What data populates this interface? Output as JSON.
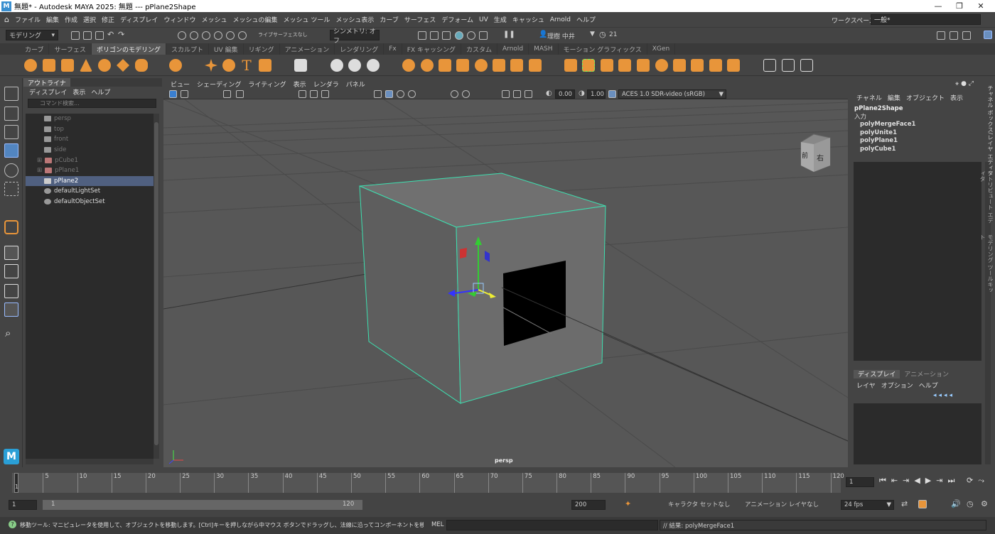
{
  "app": {
    "title": "無題* - Autodesk MAYA 2025: 無題   ---   pPlane2Shape",
    "logo": "M"
  },
  "window_controls": {
    "minimize": "—",
    "maximize": "❐",
    "close": "✕"
  },
  "menubar": {
    "items": [
      "ファイル",
      "編集",
      "作成",
      "選択",
      "修正",
      "ディスプレイ",
      "ウィンドウ",
      "メッシュ",
      "メッシュの編集",
      "メッシュ ツール",
      "メッシュ表示",
      "カーブ",
      "サーフェス",
      "デフォーム",
      "UV",
      "生成",
      "キャッシュ",
      "Arnold",
      "ヘルプ"
    ],
    "workspace_label": "ワークスペース :",
    "workspace_value": "一般*"
  },
  "statusline": {
    "mode": "モデリング",
    "live": "ライブ",
    "surface": "サーフェスなし",
    "symmetry": "シンメトリ: オフ",
    "user": "理樹 中井",
    "notifications": "21"
  },
  "shelf": {
    "tabs": [
      "カーブ",
      "サーフェス",
      "ポリゴンのモデリング",
      "スカルプト",
      "UV 編集",
      "リギング",
      "アニメーション",
      "レンダリング",
      "Fx",
      "FX キャッシング",
      "カスタム",
      "Arnold",
      "MASH",
      "モーション グラフィックス",
      "XGen"
    ],
    "active_tab": 2
  },
  "outliner": {
    "tab": "アウトライナ",
    "menu": [
      "ディスプレイ",
      "表示",
      "ヘルプ"
    ],
    "search_placeholder": "コマンド検索...",
    "items": [
      {
        "label": "persp",
        "dim": true
      },
      {
        "label": "top",
        "dim": true
      },
      {
        "label": "front",
        "dim": true
      },
      {
        "label": "side",
        "dim": true
      },
      {
        "label": "pCube1",
        "dim": true
      },
      {
        "label": "pPlane1",
        "dim": true
      },
      {
        "label": "pPlane2",
        "selected": true
      },
      {
        "label": "defaultLightSet"
      },
      {
        "label": "defaultObjectSet"
      }
    ]
  },
  "viewport": {
    "menu": [
      "ビュー",
      "シェーディング",
      "ライティング",
      "表示",
      "レンダラ",
      "パネル"
    ],
    "exposure": "0.00",
    "gamma": "1.00",
    "colorspace": "ACES 1.0 SDR-video (sRGB)",
    "camera_label": "persp",
    "viewcube": {
      "front": "前",
      "right": "右"
    }
  },
  "channelbox": {
    "menu": [
      "チャネル",
      "編集",
      "オブジェクト",
      "表示"
    ],
    "shape": "pPlane2Shape",
    "input_label": "入力",
    "inputs": [
      "polyMergeFace1",
      "polyUnite1",
      "polyPlane1",
      "polyCube1"
    ],
    "side_tabs": [
      "チャネル ボックス/レイヤ エディタ",
      "アトリビュート エディタ",
      "モデリング ツールキット"
    ],
    "layer_tabs": [
      "ディスプレイ",
      "アニメーション"
    ],
    "layer_menu": [
      "レイヤ",
      "オプション",
      "ヘルプ"
    ]
  },
  "timeline": {
    "ticks": [
      "5",
      "10",
      "15",
      "20",
      "25",
      "30",
      "35",
      "40",
      "45",
      "50",
      "55",
      "60",
      "65",
      "70",
      "75",
      "80",
      "85",
      "90",
      "95",
      "100",
      "105",
      "110",
      "115",
      "120"
    ],
    "start_marker": "1",
    "current_frame": "1"
  },
  "range": {
    "start": "1",
    "inner_start": "1",
    "inner_end": "120",
    "end": "200",
    "character": "キャラクタ セットなし",
    "anim_layer": "アニメーション レイヤなし",
    "fps": "24 fps"
  },
  "helpline": {
    "text": "移動ツール: マニピュレータを使用して、オブジェクトを移動します。[Ctrl]キーを押しながら中マウス ボタンでドラッグし、法線に沿ってコンポーネントを移動します。[Shift]キーを押しながらマニ",
    "mel_label": "MEL",
    "result": "// 結果: polyMergeFace1"
  }
}
